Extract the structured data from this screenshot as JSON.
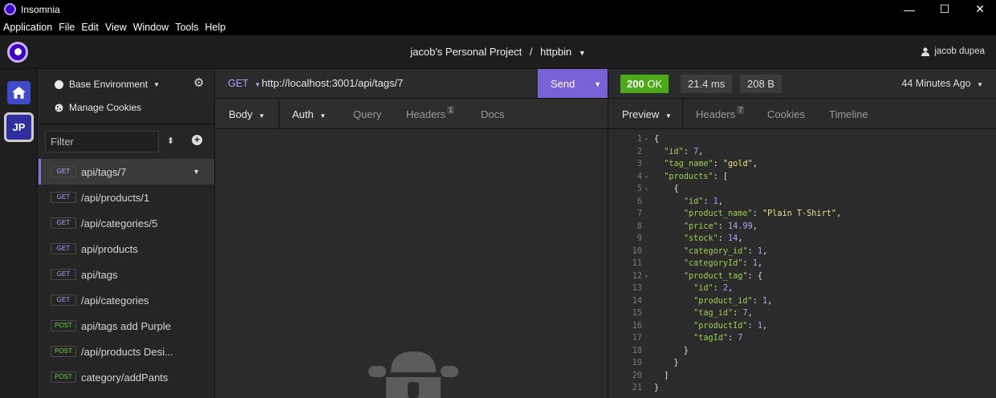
{
  "window": {
    "title": "Insomnia",
    "controls": [
      "—",
      "☐",
      "✕"
    ]
  },
  "menu": [
    "Application",
    "File",
    "Edit",
    "View",
    "Window",
    "Tools",
    "Help"
  ],
  "header": {
    "project": "jacob's Personal Project",
    "separator": "/",
    "collection": "httpbin",
    "user": "jacob dupea"
  },
  "rail": {
    "home_icon": "home-icon",
    "workspace_initials": "JP"
  },
  "sidebar": {
    "environment": "Base Environment",
    "manage_cookies": "Manage Cookies",
    "filter_placeholder": "Filter",
    "requests": [
      {
        "method": "GET",
        "name": "api/tags/7",
        "active": true
      },
      {
        "method": "GET",
        "name": "/api/products/1"
      },
      {
        "method": "GET",
        "name": "/api/categories/5"
      },
      {
        "method": "GET",
        "name": "api/products"
      },
      {
        "method": "GET",
        "name": "api/tags"
      },
      {
        "method": "GET",
        "name": "/api/categories"
      },
      {
        "method": "POST",
        "name": "api/tags add Purple"
      },
      {
        "method": "POST",
        "name": "/api/products Desi..."
      },
      {
        "method": "POST",
        "name": "category/addPants"
      }
    ]
  },
  "request": {
    "method": "GET",
    "url": "http://localhost:3001/api/tags/7",
    "send_label": "Send",
    "tabs": {
      "body": "Body",
      "auth": "Auth",
      "query": "Query",
      "headers": "Headers",
      "headers_count": "1",
      "docs": "Docs"
    }
  },
  "response": {
    "status_code": "200",
    "status_text": "OK",
    "time": "21.4 ms",
    "size": "208 B",
    "ago": "44 Minutes Ago",
    "tabs": {
      "preview": "Preview",
      "headers": "Headers",
      "headers_count": "7",
      "cookies": "Cookies",
      "timeline": "Timeline"
    },
    "lines": [
      "{",
      "  \"id\": 7,",
      "  \"tag_name\": \"gold\",",
      "  \"products\": [",
      "    {",
      "      \"id\": 1,",
      "      \"product_name\": \"Plain T-Shirt\",",
      "      \"price\": 14.99,",
      "      \"stock\": 14,",
      "      \"category_id\": 1,",
      "      \"categoryId\": 1,",
      "      \"product_tag\": {",
      "        \"id\": 2,",
      "        \"product_id\": 1,",
      "        \"tag_id\": 7,",
      "        \"productId\": 1,",
      "        \"tagId\": 7",
      "      }",
      "    }",
      "  ]",
      "}"
    ],
    "fold_lines": [
      1,
      4,
      5,
      12
    ]
  },
  "colors": {
    "accent": "#7b61d6",
    "ok": "#4caa1a",
    "get": "#b79cff",
    "post": "#6fcf40",
    "json_key": "#9ad04f",
    "json_string": "#f5e08a",
    "json_number": "#b79cff"
  }
}
